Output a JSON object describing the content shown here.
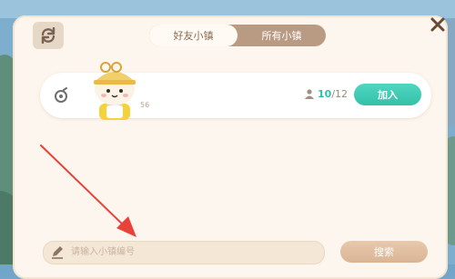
{
  "tabs": [
    {
      "label": "好友小镇",
      "active": true
    },
    {
      "label": "所有小镇",
      "active": false
    }
  ],
  "town": {
    "level": "56",
    "members_current": "10",
    "members_max": "/12",
    "join_label": "加入"
  },
  "search": {
    "placeholder": "请输入小镇编号",
    "button_label": "搜索"
  },
  "icons": {
    "refresh": "refresh-icon",
    "close": "close-icon",
    "pencil": "pencil-icon",
    "member": "person-icon",
    "town_badge": "swirl-icon"
  },
  "colors": {
    "accent_teal": "#34c0aa",
    "panel_bg": "#fdf6ee",
    "tab_bar": "#b99a82",
    "arrow_red": "#e8433a"
  }
}
